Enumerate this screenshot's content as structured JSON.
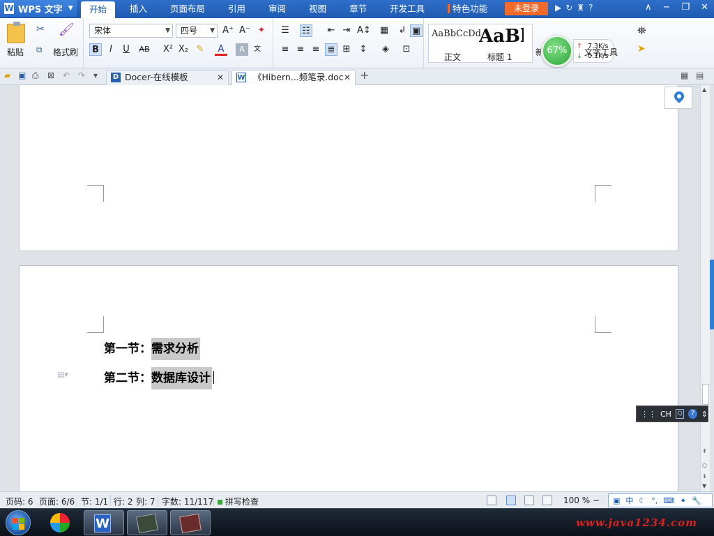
{
  "app": {
    "name": "WPS 文字",
    "menu": [
      "开始",
      "插入",
      "页面布局",
      "引用",
      "审阅",
      "视图",
      "章节",
      "开发工具",
      "特色功能"
    ],
    "login": "未登录"
  },
  "ribbon": {
    "paste": "粘贴",
    "format_painter": "格式刷",
    "font_name": "宋体",
    "font_size": "四号",
    "styles": {
      "normal_preview": "AaBbCcDd",
      "heading_preview": "AaBl",
      "normal": "正文",
      "heading1": "标题 1",
      "new_style": "新样式",
      "text_tools": "文字工具"
    },
    "progress": "67%",
    "speed_up": "7.3K/s",
    "speed_down": "0.1K/s"
  },
  "tabs": [
    {
      "label": "Docer-在线模板"
    },
    {
      "label": "《Hibern...频笔录.doc"
    }
  ],
  "document": {
    "line1_prefix": "第一节：",
    "line1_rest": "需求分析",
    "line2_prefix": "第二节：",
    "line2_rest": "数据库设计"
  },
  "status": {
    "page_num": "页码: 6",
    "pages": "页面: 6/6",
    "section": "节: 1/1",
    "row": "行: 2",
    "col": "列: 7",
    "word_count": "字数: 11/117",
    "spell_check": "拼写检查",
    "zoom": "100 %"
  },
  "ime": {
    "mode": "CH"
  },
  "tray_ime": {
    "lang": "中"
  },
  "watermark": "www.java1234.com",
  "colors": {
    "title_blue": "#2f6fc9",
    "login_orange": "#f26a2a",
    "selection": "#c9c9c9"
  }
}
